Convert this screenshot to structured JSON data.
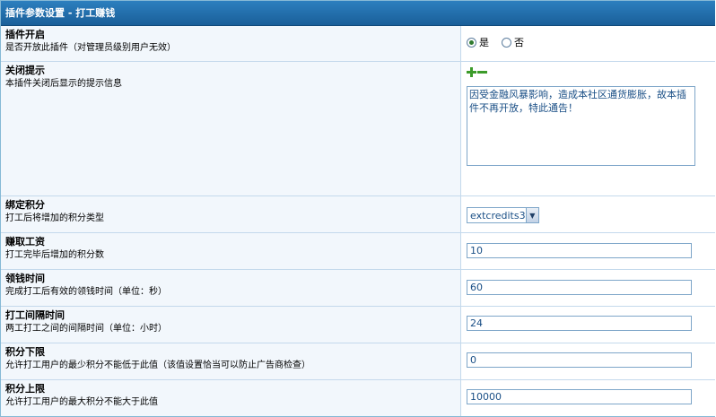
{
  "header": {
    "title": "插件参数设置 - 打工赚钱"
  },
  "rows": [
    {
      "label": "插件开启",
      "desc": "是否开放此插件（对管理员级别用户无效）"
    },
    {
      "label": "关闭提示",
      "desc": "本插件关闭后显示的提示信息"
    },
    {
      "label": "绑定积分",
      "desc": "打工后将增加的积分类型"
    },
    {
      "label": "赚取工资",
      "desc": "打工完毕后增加的积分数"
    },
    {
      "label": "领钱时间",
      "desc": "完成打工后有效的领钱时间（单位：秒）"
    },
    {
      "label": "打工间隔时间",
      "desc": "两工打工之间的间隔时间（单位：小时）"
    },
    {
      "label": "积分下限",
      "desc": "允许打工用户的最少积分不能低于此值（该值设置恰当可以防止广告商检查）"
    },
    {
      "label": "积分上限",
      "desc": "允许打工用户的最大积分不能大于此值"
    }
  ],
  "enable": {
    "yes_label": "是",
    "no_label": "否",
    "selected": "yes"
  },
  "close_msg": {
    "value": "因受金融风暴影响，造成本社区通货膨胀，故本插件不再开放，特此通告！"
  },
  "credit_type": {
    "value": "extcredits3"
  },
  "wage": {
    "value": "10"
  },
  "collect_time": {
    "value": "60"
  },
  "interval": {
    "value": "24"
  },
  "min_credits": {
    "value": "0"
  },
  "max_credits": {
    "value": "10000"
  }
}
